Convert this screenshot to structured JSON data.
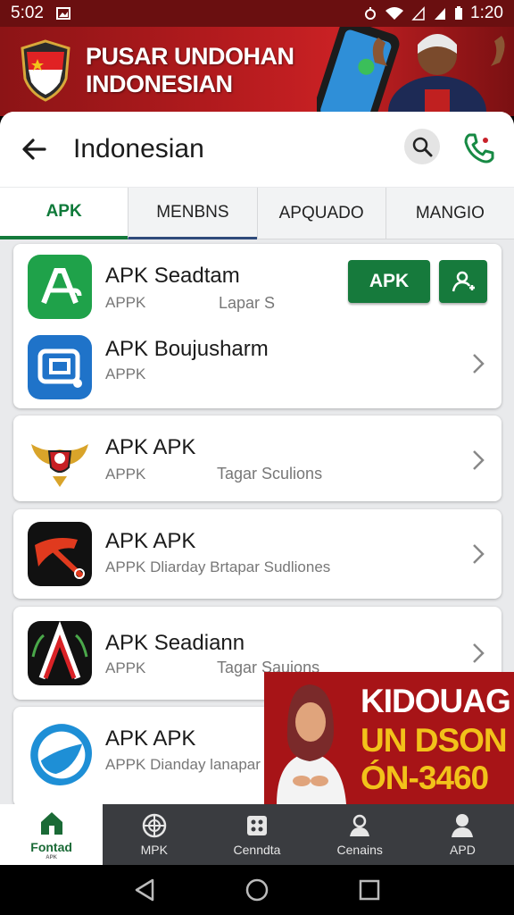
{
  "status_bar": {
    "time_left": "5:02",
    "time_right": "1:20",
    "icons": [
      "image-icon",
      "alarm-icon",
      "wifi-icon",
      "signal-icon",
      "battery-icon"
    ]
  },
  "banner": {
    "title_line1": "PUSAR UNDOHAN",
    "title_line2": "INDONESIAN"
  },
  "header": {
    "title": "Indonesian"
  },
  "tabs": [
    {
      "label": "APK"
    },
    {
      "label": "MENBNS"
    },
    {
      "label": "APQUADO"
    },
    {
      "label": "MANGIO"
    }
  ],
  "apps": [
    {
      "name": "APK Seadtam",
      "sub": "APPK",
      "sub2": "Lapar S",
      "icon": "green-a-icon",
      "action_label": "APK"
    },
    {
      "name": "APK Boujusharm",
      "sub": "APPK",
      "sub2": "",
      "icon": "blue-chat-icon"
    },
    {
      "name": "APK APK",
      "sub": "APPK",
      "sub2": "Tagar Sculions",
      "icon": "garuda-emblem-icon"
    },
    {
      "name": "APK APK",
      "sub": "APPK Dliarday Brtapar Sudliones",
      "sub2": "",
      "icon": "red-tool-icon"
    },
    {
      "name": "APK Seadiann",
      "sub": "APPK",
      "sub2": "Tagar Sauions",
      "icon": "red-a-emblem-icon"
    },
    {
      "name": "APK APK",
      "sub": "APPK Dianday lanapar S",
      "sub2": "",
      "icon": "blue-globe-icon"
    }
  ],
  "ad": {
    "line1": "KIDOUAG",
    "line2": "UN DSON",
    "line3": "ÓN-3460"
  },
  "bottom_nav": [
    {
      "label": "Fontad",
      "sub": "APK",
      "icon": "home-icon"
    },
    {
      "label": "MPK",
      "icon": "globe-icon"
    },
    {
      "label": "Cenndta",
      "icon": "grid-icon"
    },
    {
      "label": "Cenains",
      "icon": "person-group-icon"
    },
    {
      "label": "APD",
      "icon": "profile-icon"
    }
  ],
  "colors": {
    "brand_red": "#b51b1e",
    "brand_green": "#167a3c",
    "ad_yellow": "#f2c21a"
  }
}
